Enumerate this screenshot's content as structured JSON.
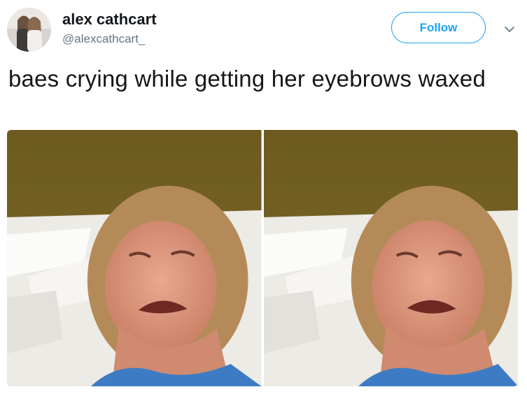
{
  "tweet": {
    "author": {
      "name": "alex cathcart",
      "handle": "@alexcathcart_"
    },
    "follow_label": "Follow",
    "text": "baes crying while getting her eyebrows waxed",
    "media": [
      {
        "kind": "photo"
      },
      {
        "kind": "photo"
      }
    ]
  },
  "colors": {
    "accent": "#1da1f2",
    "text": "#14171a",
    "secondary": "#657786"
  },
  "icons": {
    "more": "chevron-down-icon"
  }
}
